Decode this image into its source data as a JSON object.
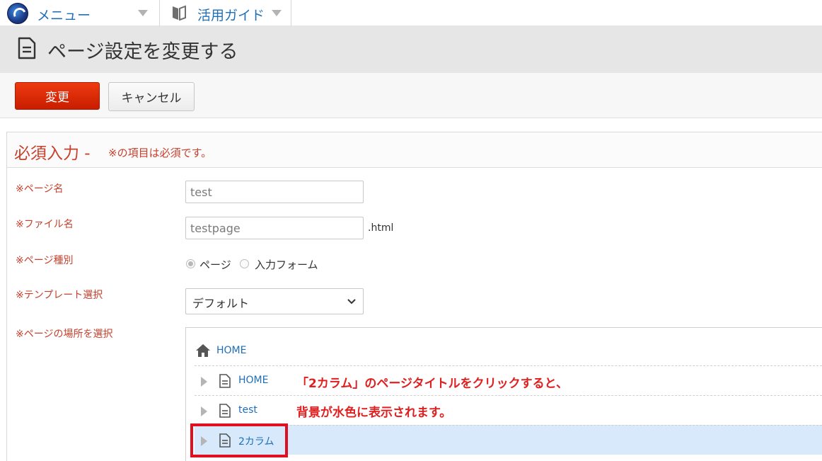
{
  "topbar": {
    "menu_label": "メニュー",
    "guide_label": "活用ガイド"
  },
  "header": {
    "title": "ページ設定を変更する"
  },
  "actions": {
    "change_label": "変更",
    "cancel_label": "キャンセル"
  },
  "form": {
    "required_heading": "必須入力 -",
    "required_note": "※の項目は必須です。",
    "page_name": {
      "label": "※ページ名",
      "value": "test"
    },
    "file_name": {
      "label": "※ファイル名",
      "value": "testpage",
      "suffix": ".html"
    },
    "page_type": {
      "label": "※ページ種別",
      "options": [
        "ページ",
        "入力フォーム"
      ],
      "selected": "ページ"
    },
    "template": {
      "label": "※テンプレート選択",
      "value": "デフォルト"
    },
    "location": {
      "label": "※ページの場所を選択"
    }
  },
  "tree": {
    "root_label": "HOME",
    "items": [
      {
        "label": "HOME",
        "selected": false
      },
      {
        "label": "test",
        "selected": false
      },
      {
        "label": "2カラム",
        "selected": true
      }
    ],
    "selected_color": "#d7e9fb"
  },
  "annotation": {
    "line1": "「2カラム」のページタイトルをクリックすると、",
    "line2": "背景が水色に表示されます。",
    "color": "#e02020"
  },
  "colors": {
    "accent": "#1f6fb8",
    "required": "#c7402d",
    "primary_button": "#dd2c06"
  }
}
